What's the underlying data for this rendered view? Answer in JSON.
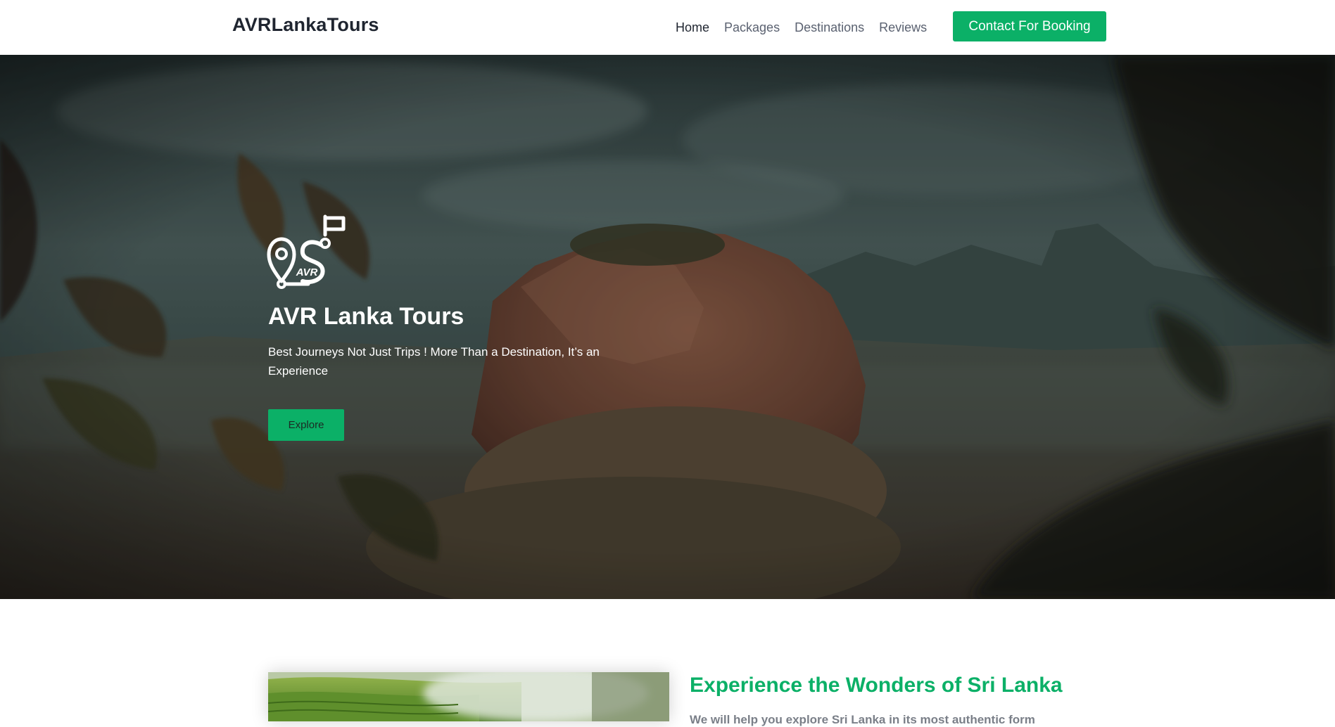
{
  "header": {
    "brand": "AVRLankaTours",
    "nav": [
      {
        "label": "Home",
        "active": true
      },
      {
        "label": "Packages",
        "active": false
      },
      {
        "label": "Destinations",
        "active": false
      },
      {
        "label": "Reviews",
        "active": false
      }
    ],
    "cta_label": "Contact For Booking"
  },
  "hero": {
    "logo_text": "AVR",
    "title": "AVR Lanka Tours",
    "subtitle": "Best Journeys Not Just Trips ! More Than a Destination, It’s an Experience",
    "button_label": "Explore",
    "background_image": "sigiriya-rock-photo"
  },
  "intro": {
    "heading": "Experience the Wonders of Sri Lanka",
    "text": "We will help you explore Sri Lanka in its most authentic form",
    "image": "tea-plantation-photo"
  },
  "colors": {
    "accent": "#0bb067",
    "brand_text": "#1f2530",
    "nav_text": "#5a6170"
  }
}
